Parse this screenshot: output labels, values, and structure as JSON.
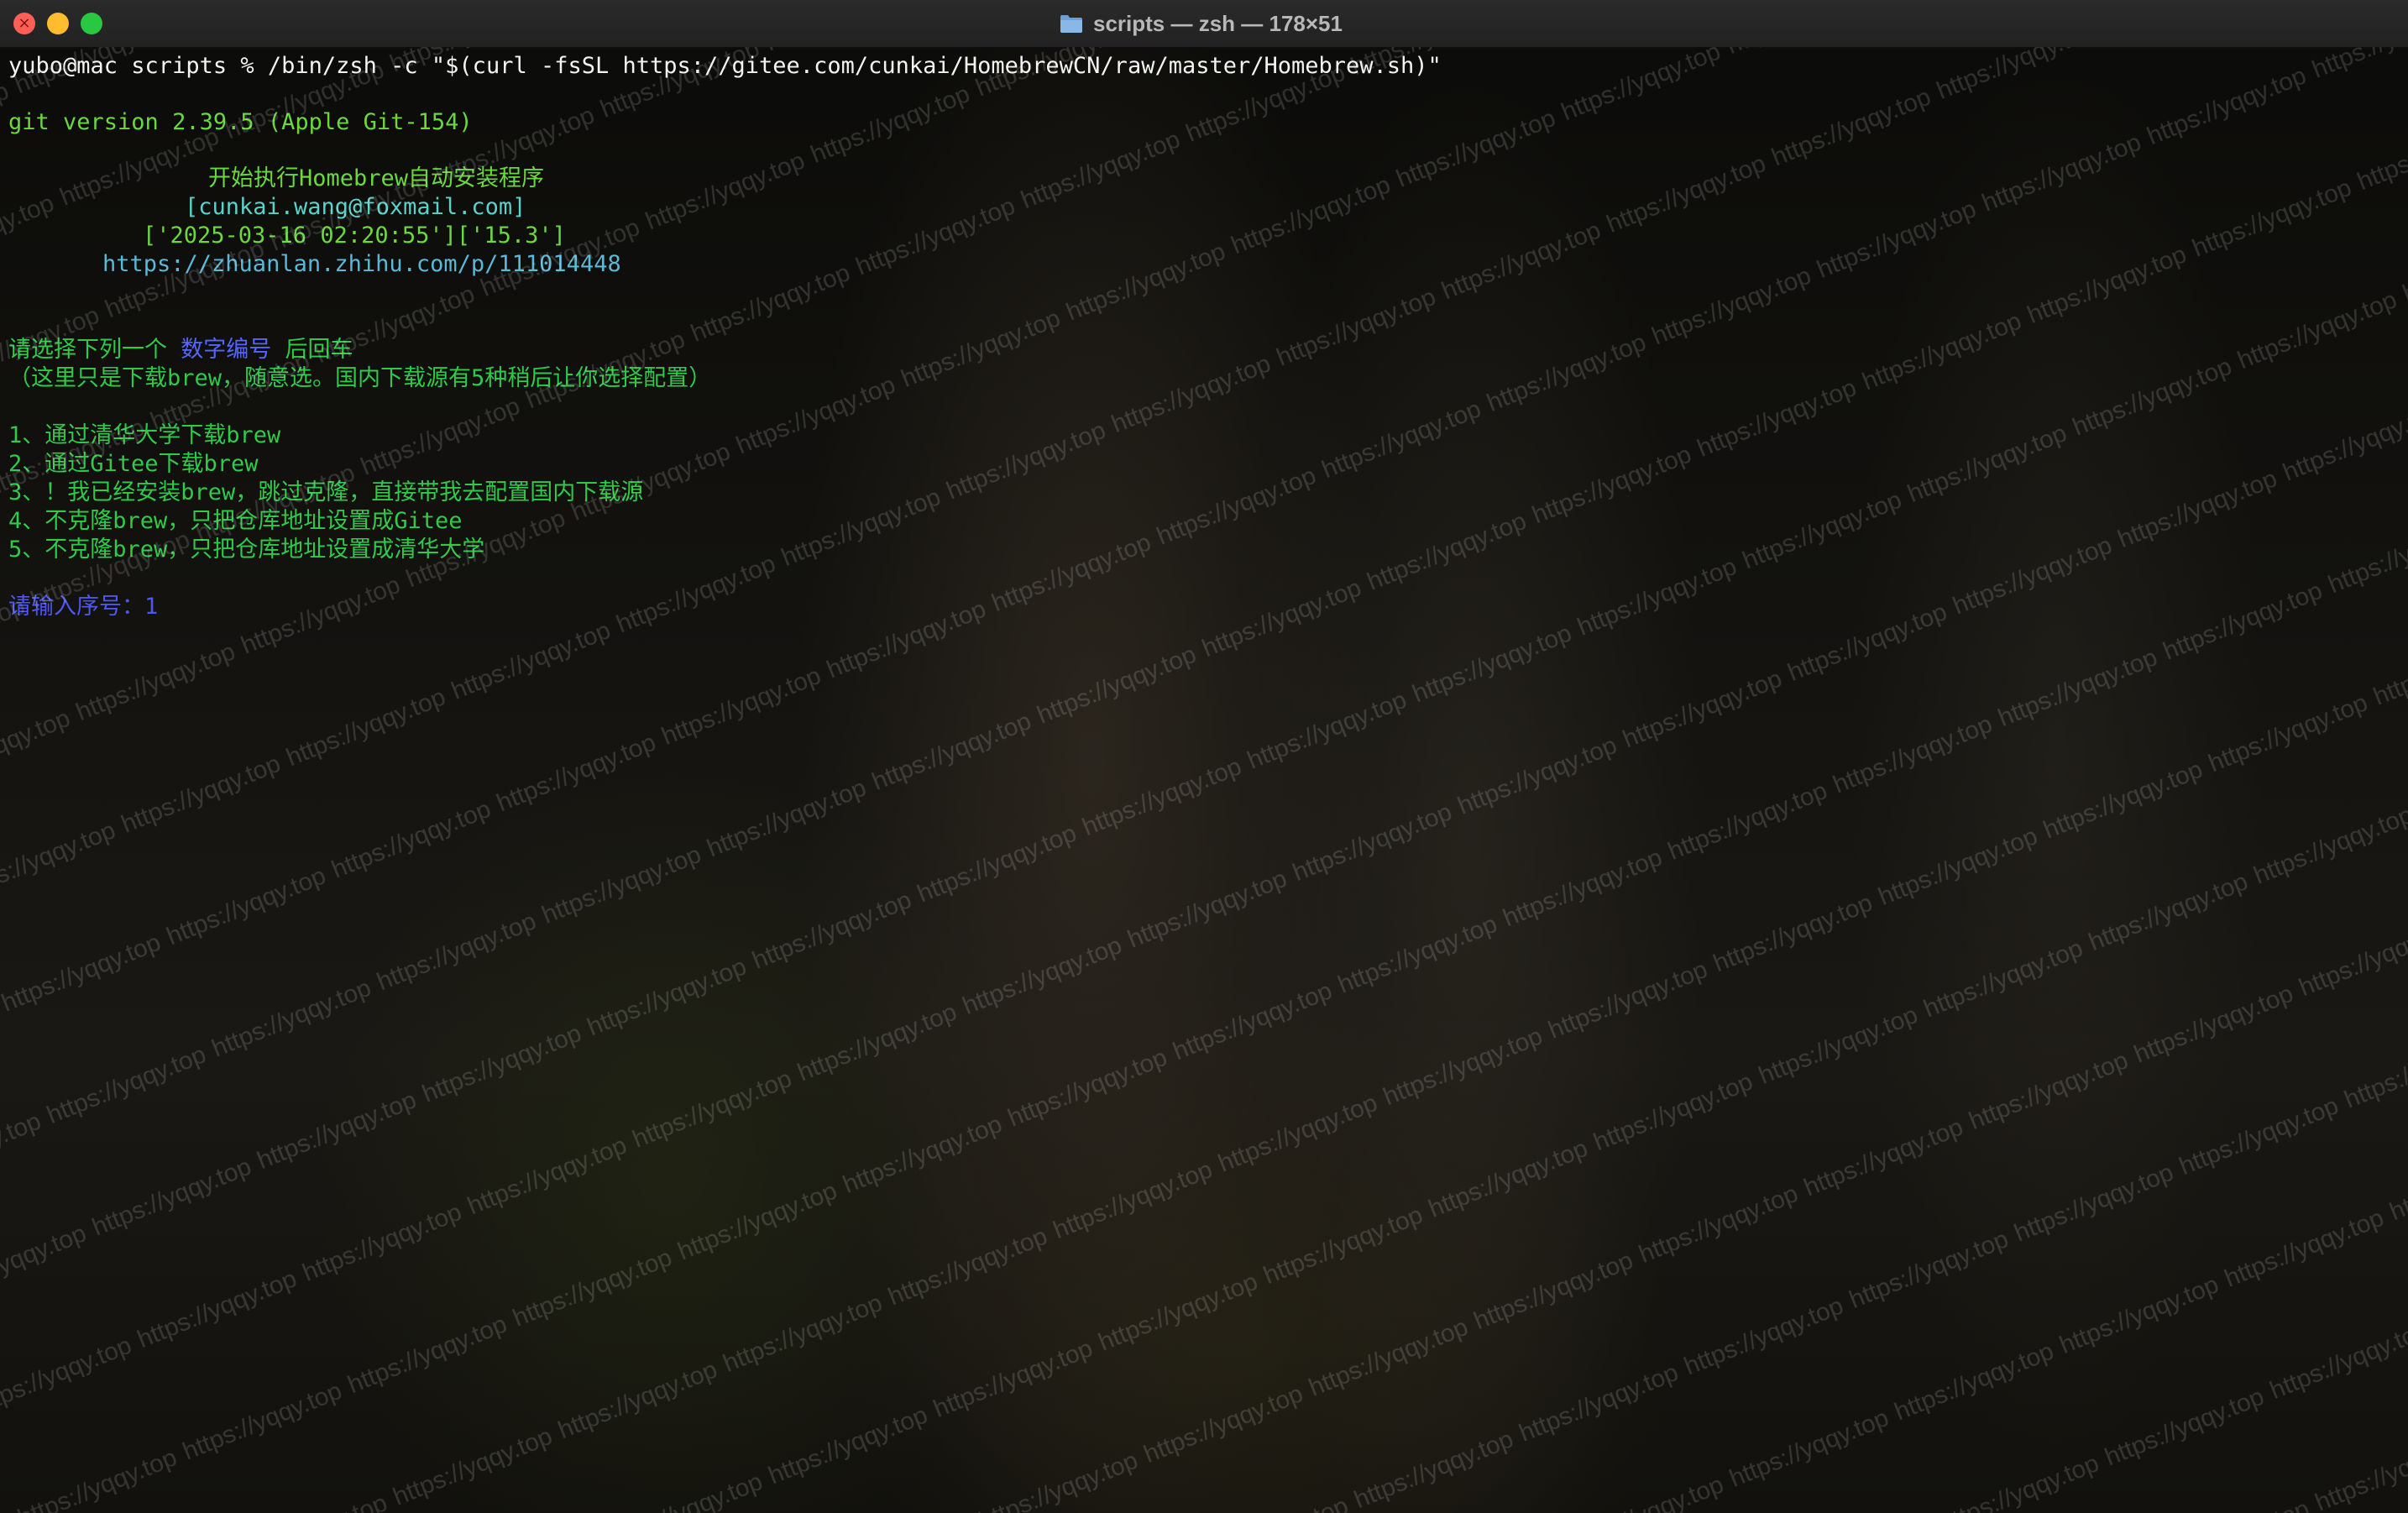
{
  "window": {
    "title": "scripts — zsh — 178×51",
    "folder_icon": "folder-icon",
    "controls": [
      "close",
      "minimize",
      "zoom"
    ]
  },
  "colors": {
    "prompt": "#f3f3f3",
    "output_green": "#30c94a",
    "header_green": "#6ad83e",
    "email_cyan": "#5ad2c8",
    "link_cyan": "#5ab8d8",
    "highlight_purple": "#5566ff",
    "input_purple": "#4f56ee"
  },
  "terminal": {
    "command_line": "yubo@mac scripts % /bin/zsh -c \"$(curl -fsSL https://gitee.com/cunkai/HomebrewCN/raw/master/Homebrew.sh)\"",
    "git_version": "git version 2.39.5 (Apple Git-154)",
    "banner": {
      "title": "开始执行Homebrew自动安装程序",
      "email": "[cunkai.wang@foxmail.com]",
      "datetime": "['2025-03-16 02:20:55']['15.3']",
      "link": "https://zhuanlan.zhihu.com/p/111014448"
    },
    "prompt_select": {
      "before": "请选择下列一个 ",
      "highlight": "数字编号",
      "after": " 后回车"
    },
    "note": "（这里只是下载brew，随意选。国内下载源有5种稍后让你选择配置）",
    "options": [
      "1、通过清华大学下载brew",
      "2、通过Gitee下载brew",
      "3、！我已经安装brew，跳过克隆，直接带我去配置国内下载源",
      "4、不克隆brew，只把仓库地址设置成Gitee",
      "5、不克隆brew，只把仓库地址设置成清华大学"
    ],
    "input_prompt": "请输入序号：",
    "input_value": "1"
  },
  "watermark": "https://yqqy.top"
}
